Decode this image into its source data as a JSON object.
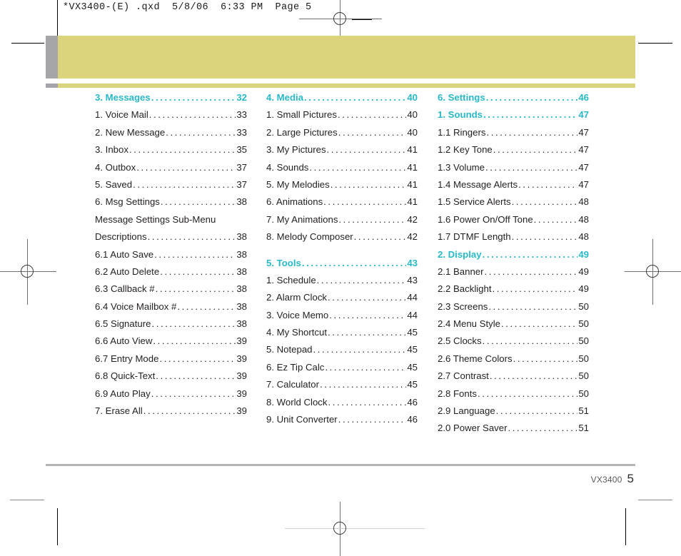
{
  "prepress": {
    "header_line": "*VX3400-(E) .qxd  5/8/06  6:33 PM  Page 5"
  },
  "colors": {
    "heading": "#29b8c8",
    "banner_khaki": "#dcd47c",
    "banner_grey": "#a6a6aa",
    "body_text": "#231f20",
    "footer_rule": "#b5b5b5"
  },
  "toc": {
    "columns": [
      {
        "id": "column-1",
        "entries": [
          {
            "label": "3. Messages",
            "page": "32",
            "heading": true,
            "leader": true
          },
          {
            "label": "1. Voice Mail",
            "page": "33",
            "heading": false,
            "leader": true
          },
          {
            "label": "2. New Message",
            "page": "33",
            "heading": false,
            "leader": true
          },
          {
            "label": "3. Inbox",
            "page": "35",
            "heading": false,
            "leader": true
          },
          {
            "label": "4. Outbox",
            "page": "37",
            "heading": false,
            "leader": true
          },
          {
            "label": "5. Saved",
            "page": "37",
            "heading": false,
            "leader": true
          },
          {
            "label": "6. Msg Settings",
            "page": "38",
            "heading": false,
            "leader": true
          },
          {
            "label": "Message Settings Sub-Menu",
            "page": "",
            "heading": false,
            "leader": false
          },
          {
            "label": "Descriptions",
            "page": "38",
            "heading": false,
            "leader": true
          },
          {
            "label": "6.1 Auto Save",
            "page": "38",
            "heading": false,
            "leader": true
          },
          {
            "label": "6.2 Auto Delete",
            "page": "38",
            "heading": false,
            "leader": true
          },
          {
            "label": "6.3 Callback #",
            "page": "38",
            "heading": false,
            "leader": true
          },
          {
            "label": "6.4 Voice Mailbox #",
            "page": "38",
            "heading": false,
            "leader": true
          },
          {
            "label": "6.5 Signature",
            "page": "38",
            "heading": false,
            "leader": true
          },
          {
            "label": "6.6 Auto View",
            "page": "39",
            "heading": false,
            "leader": true
          },
          {
            "label": "6.7 Entry Mode",
            "page": "39",
            "heading": false,
            "leader": true
          },
          {
            "label": "6.8 Quick-Text",
            "page": "39",
            "heading": false,
            "leader": true
          },
          {
            "label": "6.9 Auto Play",
            "page": "39",
            "heading": false,
            "leader": true
          },
          {
            "label": "7. Erase All",
            "page": "39",
            "heading": false,
            "leader": true
          }
        ]
      },
      {
        "id": "column-2",
        "entries": [
          {
            "label": "4. Media",
            "page": "40",
            "heading": true,
            "leader": true
          },
          {
            "label": "1. Small Pictures",
            "page": "40",
            "heading": false,
            "leader": true
          },
          {
            "label": "2. Large Pictures",
            "page": "40",
            "heading": false,
            "leader": true
          },
          {
            "label": "3. My Pictures",
            "page": "41",
            "heading": false,
            "leader": true
          },
          {
            "label": "4. Sounds",
            "page": "41",
            "heading": false,
            "leader": true
          },
          {
            "label": "5. My Melodies",
            "page": "41",
            "heading": false,
            "leader": true
          },
          {
            "label": "6. Animations",
            "page": "41",
            "heading": false,
            "leader": true
          },
          {
            "label": "7. My Animations",
            "page": "42",
            "heading": false,
            "leader": true
          },
          {
            "label": "8. Melody Composer",
            "page": "42",
            "heading": false,
            "leader": true
          },
          {
            "label": "__GAP__",
            "page": "",
            "heading": false,
            "leader": false
          },
          {
            "label": "5. Tools",
            "page": "43",
            "heading": true,
            "leader": true
          },
          {
            "label": "1. Schedule",
            "page": "43",
            "heading": false,
            "leader": true
          },
          {
            "label": "2. Alarm Clock",
            "page": "44",
            "heading": false,
            "leader": true
          },
          {
            "label": "3. Voice Memo",
            "page": "44",
            "heading": false,
            "leader": true
          },
          {
            "label": "4. My Shortcut",
            "page": "45",
            "heading": false,
            "leader": true
          },
          {
            "label": "5. Notepad",
            "page": "45",
            "heading": false,
            "leader": true
          },
          {
            "label": "6. Ez Tip Calc",
            "page": "45",
            "heading": false,
            "leader": true
          },
          {
            "label": "7. Calculator",
            "page": "45",
            "heading": false,
            "leader": true
          },
          {
            "label": "8. World Clock",
            "page": "46",
            "heading": false,
            "leader": true
          },
          {
            "label": "9. Unit Converter",
            "page": "46",
            "heading": false,
            "leader": true
          }
        ]
      },
      {
        "id": "column-3",
        "entries": [
          {
            "label": "6. Settings",
            "page": "46",
            "heading": true,
            "leader": true
          },
          {
            "label": "1. Sounds",
            "page": "47",
            "heading": true,
            "leader": true
          },
          {
            "label": "1.1 Ringers",
            "page": "47",
            "heading": false,
            "leader": true
          },
          {
            "label": "1.2 Key Tone",
            "page": "47",
            "heading": false,
            "leader": true
          },
          {
            "label": "1.3 Volume",
            "page": "47",
            "heading": false,
            "leader": true
          },
          {
            "label": "1.4 Message Alerts",
            "page": "47",
            "heading": false,
            "leader": true
          },
          {
            "label": "1.5 Service Alerts",
            "page": "48",
            "heading": false,
            "leader": true
          },
          {
            "label": "1.6 Power On/Off Tone",
            "page": "48",
            "heading": false,
            "leader": true
          },
          {
            "label": "1.7 DTMF Length",
            "page": "48",
            "heading": false,
            "leader": true
          },
          {
            "label": "2. Display",
            "page": "49",
            "heading": true,
            "leader": true
          },
          {
            "label": "2.1 Banner",
            "page": "49",
            "heading": false,
            "leader": true
          },
          {
            "label": "2.2 Backlight",
            "page": "49",
            "heading": false,
            "leader": true
          },
          {
            "label": "2.3 Screens",
            "page": "50",
            "heading": false,
            "leader": true
          },
          {
            "label": "2.4 Menu Style",
            "page": "50",
            "heading": false,
            "leader": true
          },
          {
            "label": "2.5 Clocks",
            "page": "50",
            "heading": false,
            "leader": true
          },
          {
            "label": "2.6 Theme Colors",
            "page": "50",
            "heading": false,
            "leader": true
          },
          {
            "label": "2.7 Contrast",
            "page": "50",
            "heading": false,
            "leader": true
          },
          {
            "label": "2.8 Fonts",
            "page": "50",
            "heading": false,
            "leader": true
          },
          {
            "label": "2.9 Language",
            "page": "51",
            "heading": false,
            "leader": true
          },
          {
            "label": "2.0 Power Saver",
            "page": "51",
            "heading": false,
            "leader": true
          }
        ]
      }
    ]
  },
  "footer": {
    "model": "VX3400",
    "page_number": "5"
  }
}
